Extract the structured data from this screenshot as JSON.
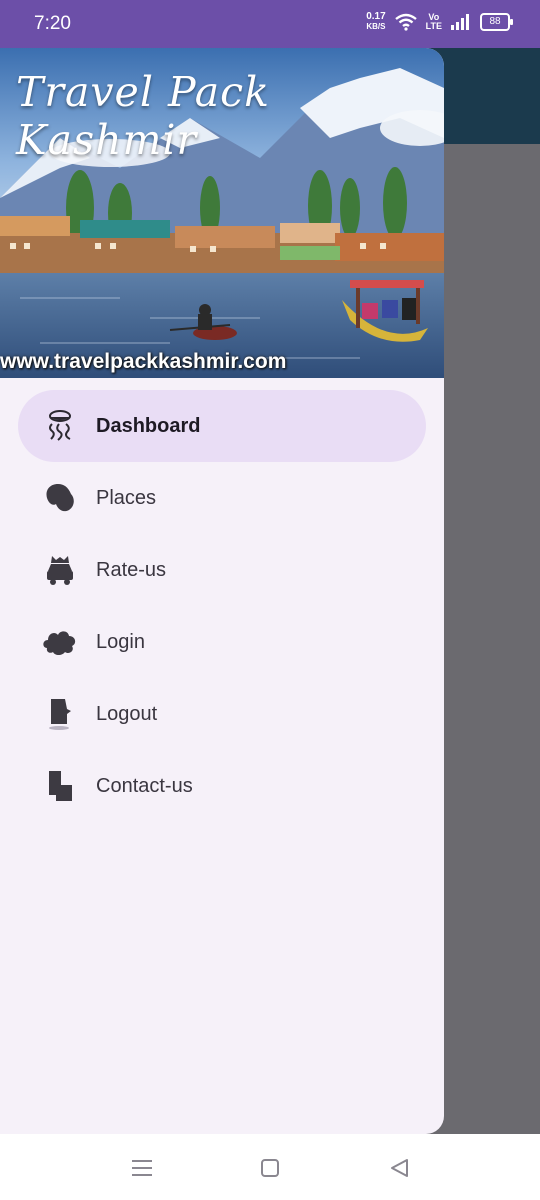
{
  "status_bar": {
    "time": "7:20",
    "net_speed_value": "0.17",
    "net_speed_unit": "KB/S",
    "volte_top": "Vo",
    "volte_bottom": "LTE",
    "battery": "88"
  },
  "drawer": {
    "header_title": "Travel Pack Kashmir",
    "header_url": "www.travelpackkashmir.com",
    "items": [
      {
        "label": "Dashboard",
        "icon": "dashboard-icon",
        "active": true
      },
      {
        "label": "Places",
        "icon": "places-icon",
        "active": false
      },
      {
        "label": "Rate-us",
        "icon": "rate-us-icon",
        "active": false
      },
      {
        "label": "Login",
        "icon": "login-icon",
        "active": false
      },
      {
        "label": "Logout",
        "icon": "logout-icon",
        "active": false
      },
      {
        "label": "Contact-us",
        "icon": "contact-us-icon",
        "active": false
      }
    ]
  },
  "colors": {
    "status_bar": "#6c4fa8",
    "app_toolbar": "#1b3a4d",
    "scrim": "#6b6a6f",
    "drawer_bg": "#f6f1f9",
    "active_item_bg": "#e9ddf5",
    "icon": "#3d3a42"
  },
  "nav_bar": {
    "buttons": [
      "menu-icon",
      "home-icon",
      "back-icon"
    ]
  }
}
